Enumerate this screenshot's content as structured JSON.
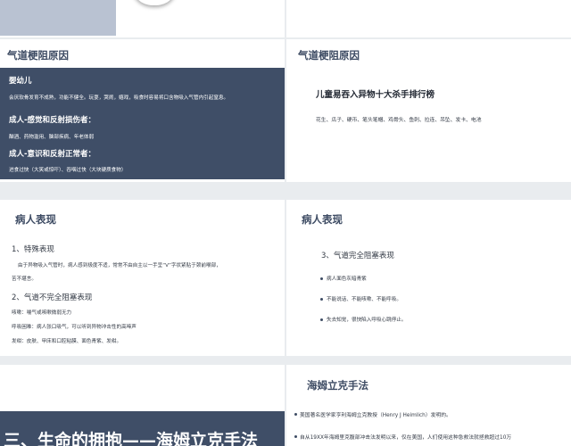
{
  "colors": {
    "navy": "#3f4e67",
    "title": "#3d4b63",
    "text": "#333a45",
    "bg": "#e9ecef"
  },
  "s3": {
    "title": "气道梗阻原因",
    "infant_head": "婴幼儿",
    "infant_text": "会厌软骨发育不成熟，功能不健全。玩耍，哭闹，嬉戏，吸食时容易将口含物吸入气管内引起窒息。",
    "adult1_head": "成人-感觉和反射损伤者：",
    "adult1_text": "酗酒、药物滥用、脑部疾病、年老体弱",
    "adult2_head": "成人-意识和反射正常者：",
    "adult2_text": "进食过快（大笑或惊吓）、吞咽过快（大块硬质食物）"
  },
  "s4": {
    "title": "气道梗阻原因",
    "heading": "儿童易吞入异物十大杀手排行榜",
    "list": "花生、瓜子、硬币、笔头笔帽、鸡骨头、鱼刺、拉连、吊坠、发卡、电池"
  },
  "s5": {
    "title": "病人表现",
    "sec1": "1、特殊表现",
    "sec1_line1": "由于异物吸入气管时，病人感到极度不适，常常不由自主以一手呈“V”字状紧贴于颈前喉部，",
    "sec1_line2": "苦不堪言。",
    "sec2": "2、气道不完全阻塞表现",
    "item1": "咳嗽：喘气或咳嗽微弱无力",
    "item2": "呼吸困难：病人张口吸气，可以听到异物冲击性的高啼声",
    "item3": "发绀：皮肤、甲床和口腔粘膜、面色青紫、发绀。"
  },
  "s6": {
    "title": "病人表现",
    "sec3": "3、气道完全阻塞表现",
    "b1": "病人面色灰暗青紫",
    "b2": "不能说话、不能咳嗽、不能呼吸。",
    "b3": "失去知觉，很快陷入呼吸心跳停止。"
  },
  "s7": {
    "banner": "三、生命的拥抱——海姆立克手法"
  },
  "s8": {
    "title": "海姆立克手法",
    "b1": "美国著名医学家亨利海姆立克教授（Henry J Heimlich）发明的。",
    "b2": "自从19XX年海姆里克腹部冲击法发明以来，仅在美国，人们使用这种急救法就拯救超过10万"
  }
}
